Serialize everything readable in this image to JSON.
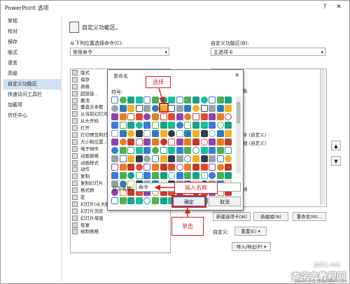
{
  "window": {
    "title": "PowerPoint 选项",
    "help": "?",
    "close": "✕"
  },
  "nav": [
    "常规",
    "校对",
    "保存",
    "版式",
    "语言",
    "高级",
    "自定义功能区",
    "快速访问工具栏",
    "加载项",
    "信任中心"
  ],
  "header": {
    "text": "自定义功能区。"
  },
  "left_panel": {
    "label": "从下列位置选择命令(C):",
    "combo_value": "常用命令",
    "commands": [
      "版式",
      "保存",
      "表格",
      "超链接...",
      "撤消",
      "垂直文本框",
      "从当前幻灯片",
      "从头开始",
      "打开",
      "打印预览和打印",
      "大小和位置...",
      "电子邮件",
      "动画窗格",
      "动画样式",
      "动作",
      "复制",
      "复制幻灯片",
      "格式刷",
      "宏",
      "幻灯片(从大纲)...",
      "幻灯片浏览",
      "幻灯片母版",
      "恢复",
      "绘制表格"
    ]
  },
  "right_panel": {
    "label": "自定义功能区(B):",
    "combo_value": "主选项卡",
    "tree": [
      "板",
      "令 (自定义)",
      "组 (自定义)",
      "映"
    ]
  },
  "buttons": {
    "new_tab": "新建选项卡(W)",
    "new_group": "新建组(N)",
    "rename": "重命名(M)...",
    "customize_label": "自定义:",
    "reset": "重置(E) ▾",
    "import_export": "导入/导出(P) ▾",
    "up": "▲",
    "down": "▼"
  },
  "dialog": {
    "title": "重命名",
    "close": "✕",
    "symbols_label": "符号:",
    "name_label": "显示名称:",
    "name_value": "命令",
    "ok": "确定",
    "cancel": "取消"
  },
  "annotations": {
    "select": "选择",
    "enter_name": "输入名称",
    "click": "单击"
  },
  "watermark": {
    "main": "查字典教程网",
    "url": "jiaocheng.chazidian.com",
    "site": "jb51.net"
  },
  "colors": {
    "annotation": "#d32222",
    "selection": "#cfe0f4",
    "accent": "#2d6ac7"
  }
}
